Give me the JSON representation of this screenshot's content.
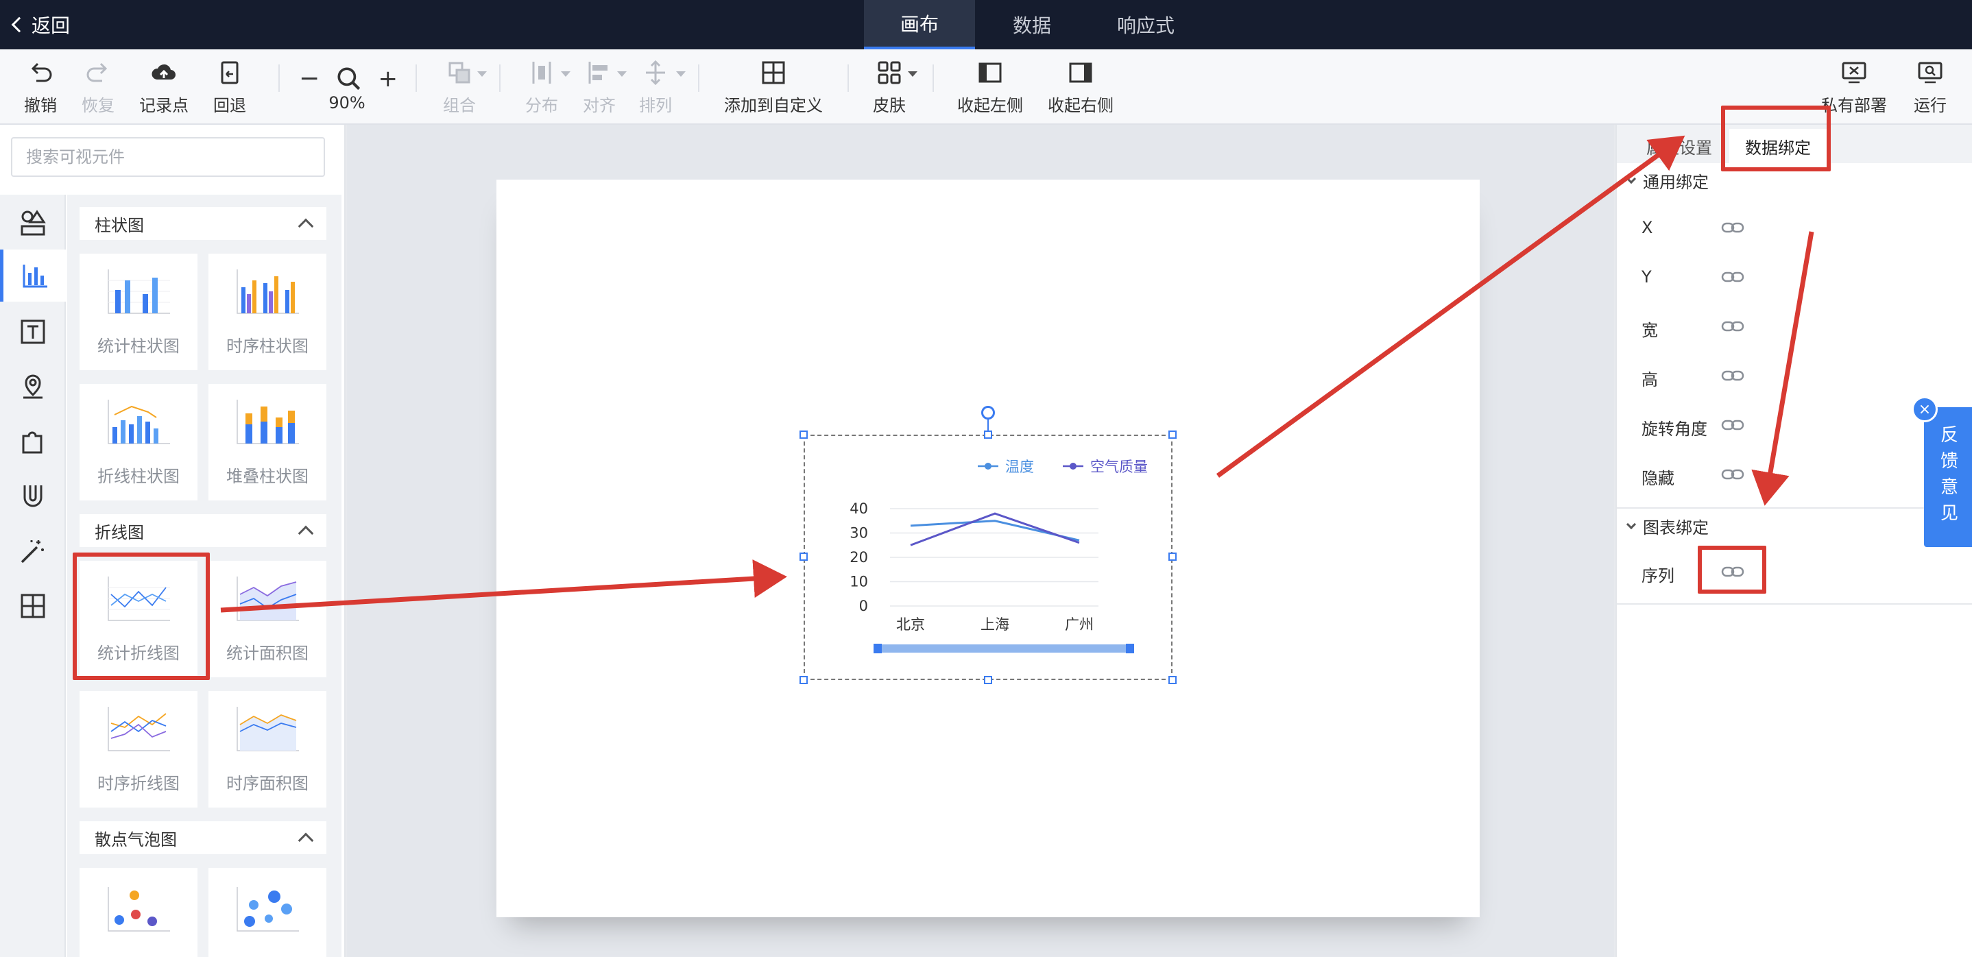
{
  "topbar": {
    "back_label": "返回",
    "tabs": [
      {
        "label": "画布"
      },
      {
        "label": "数据"
      },
      {
        "label": "响应式"
      }
    ]
  },
  "toolbar": {
    "undo": "撤销",
    "redo": "恢复",
    "record_point": "记录点",
    "rollback": "回退",
    "zoom_level": "90%",
    "group": "组合",
    "distribute": "分布",
    "align": "对齐",
    "arrange": "排列",
    "add_custom": "添加到自定义",
    "skin": "皮肤",
    "collapse_left": "收起左侧",
    "collapse_right": "收起右侧",
    "private_deploy": "私有部署",
    "run": "运行"
  },
  "leftpanel": {
    "search_placeholder": "搜索可视元件",
    "categories": [
      {
        "label": "柱状图",
        "items": [
          "统计柱状图",
          "时序柱状图",
          "折线柱状图",
          "堆叠柱状图"
        ]
      },
      {
        "label": "折线图",
        "items": [
          "统计折线图",
          "统计面积图",
          "时序折线图",
          "时序面积图"
        ]
      },
      {
        "label": "散点气泡图"
      }
    ]
  },
  "canvas": {
    "legend": [
      "温度",
      "空气质量"
    ]
  },
  "chart_data": {
    "type": "line",
    "categories": [
      "北京",
      "上海",
      "广州"
    ],
    "series": [
      {
        "name": "温度",
        "values": [
          33,
          35,
          27
        ],
        "color": "#4a8fe0"
      },
      {
        "name": "空气质量",
        "values": [
          25,
          38,
          26
        ],
        "color": "#5b57c8"
      }
    ],
    "yticks": [
      "0",
      "10",
      "20",
      "30",
      "40"
    ],
    "ylim": [
      0,
      40
    ],
    "grid": true,
    "legend": "top-right"
  },
  "rightpanel": {
    "tabs": [
      "属性设置",
      "数据绑定"
    ],
    "general_section": "通用绑定",
    "general_props": [
      "X",
      "Y",
      "宽",
      "高",
      "旋转角度",
      "隐藏"
    ],
    "chart_section": "图表绑定",
    "chart_props": [
      "序列"
    ]
  },
  "feedback": {
    "label": "反馈意见",
    "close": "×"
  },
  "colors": {
    "accent": "#3a7bf0",
    "annotation": "#d83a32",
    "topbar": "#151c2e"
  }
}
